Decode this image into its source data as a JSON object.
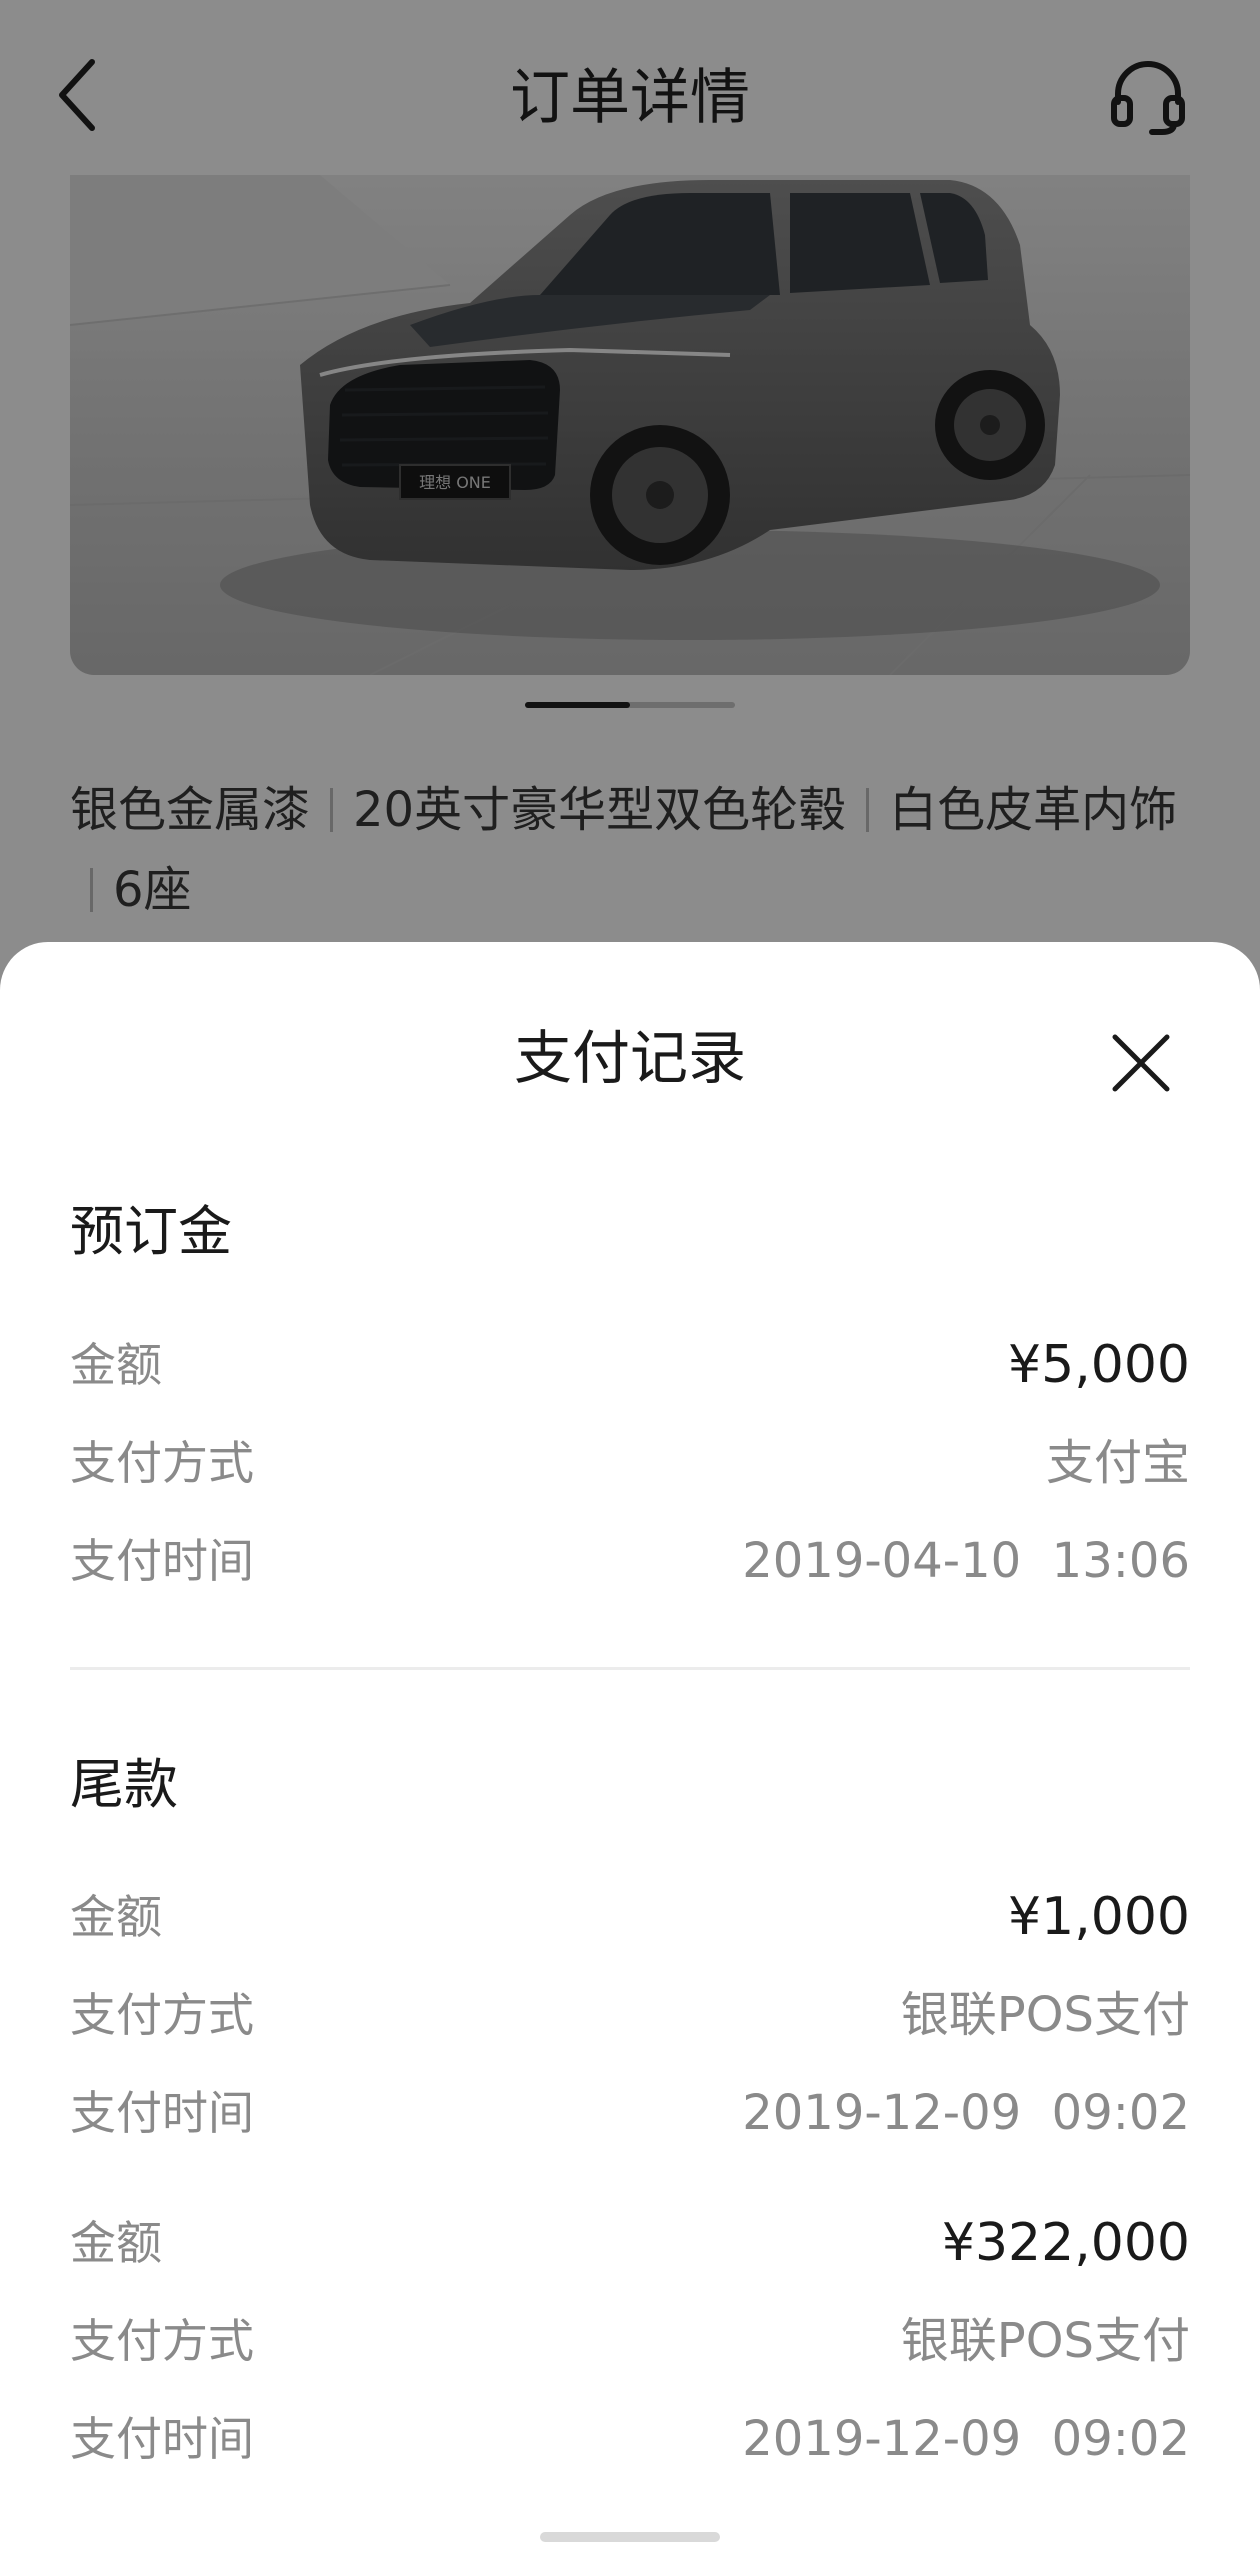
{
  "nav": {
    "title": "订单详情",
    "back_icon": "chevron-left-icon",
    "service_icon": "headset-icon"
  },
  "hero": {
    "badge_text": "理想 ONE",
    "carousel": {
      "count": 2,
      "active": 0
    }
  },
  "config": {
    "items": [
      "银色金属漆",
      "20英寸豪华型双色轮毂",
      "白色皮革内饰",
      "6座"
    ]
  },
  "sheet": {
    "title": "支付记录",
    "close_icon": "close-icon",
    "sections": [
      {
        "title": "预订金",
        "records": [
          {
            "amount_label": "金额",
            "amount": "¥5,000",
            "method_label": "支付方式",
            "method": "支付宝",
            "time_label": "支付时间",
            "time": "2019-04-10  13:06"
          }
        ]
      },
      {
        "title": "尾款",
        "records": [
          {
            "amount_label": "金额",
            "amount": "¥1,000",
            "method_label": "支付方式",
            "method": "银联POS支付",
            "time_label": "支付时间",
            "time": "2019-12-09  09:02"
          },
          {
            "amount_label": "金额",
            "amount": "¥322,000",
            "method_label": "支付方式",
            "method": "银联POS支付",
            "time_label": "支付时间",
            "time": "2019-12-09  09:02"
          }
        ]
      }
    ]
  },
  "colors": {
    "overlay": "rgba(0,0,0,0.45)",
    "text_primary": "#1a1a1a",
    "text_secondary": "#8a8a8a",
    "divider": "#ececec"
  }
}
